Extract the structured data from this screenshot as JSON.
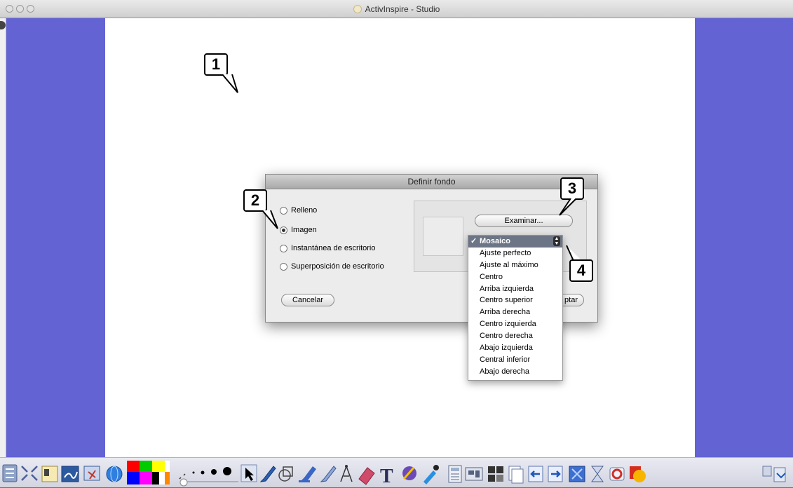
{
  "window": {
    "title": "ActivInspire - Studio"
  },
  "callouts": [
    "1",
    "2",
    "3",
    "4"
  ],
  "dialog": {
    "title": "Definir fondo",
    "options": [
      {
        "label": "Relleno",
        "selected": false
      },
      {
        "label": "Imagen",
        "selected": true
      },
      {
        "label": "Instantánea de escritorio",
        "selected": false
      },
      {
        "label": "Superposición de escritorio",
        "selected": false
      }
    ],
    "browse_label": "Examinar...",
    "cancel_label": "Cancelar",
    "accept_label_partial": "ptar"
  },
  "mode_menu": {
    "selected": "Mosaico",
    "items": [
      "Mosaico",
      "Ajuste perfecto",
      "Ajuste al máximo",
      "Centro",
      "Arriba izquierda",
      "Centro superior",
      "Arriba derecha",
      "Centro izquierda",
      "Centro derecha",
      "Abajo izquierda",
      "Central inferior",
      "Abajo derecha"
    ]
  },
  "colors": {
    "background": "#6363d4",
    "palette": [
      "#ff0000",
      "#00cc00",
      "#ffff00",
      "#0000ff",
      "#ff00ff",
      "#000000",
      "#ffffff",
      "#ffa500"
    ]
  },
  "toolbar_icons": [
    "menu-icon",
    "fullscreen-icon",
    "flipchart-icon",
    "desktop-annotate-icon",
    "desktop-tools-icon",
    "browser-icon",
    "pen-width-icon",
    "select-icon",
    "pen-icon",
    "shape-icon",
    "highlighter-icon",
    "magic-ink-icon",
    "connector-icon",
    "eraser-icon",
    "text-icon",
    "fill-icon",
    "eyedropper-icon",
    "calculator-icon",
    "camera-icon",
    "clear-icon",
    "page-icon",
    "previous-page-icon",
    "next-page-icon",
    "reset-icon",
    "tools-icon",
    "refresh-icon",
    "color-icon",
    "dock-icon"
  ]
}
